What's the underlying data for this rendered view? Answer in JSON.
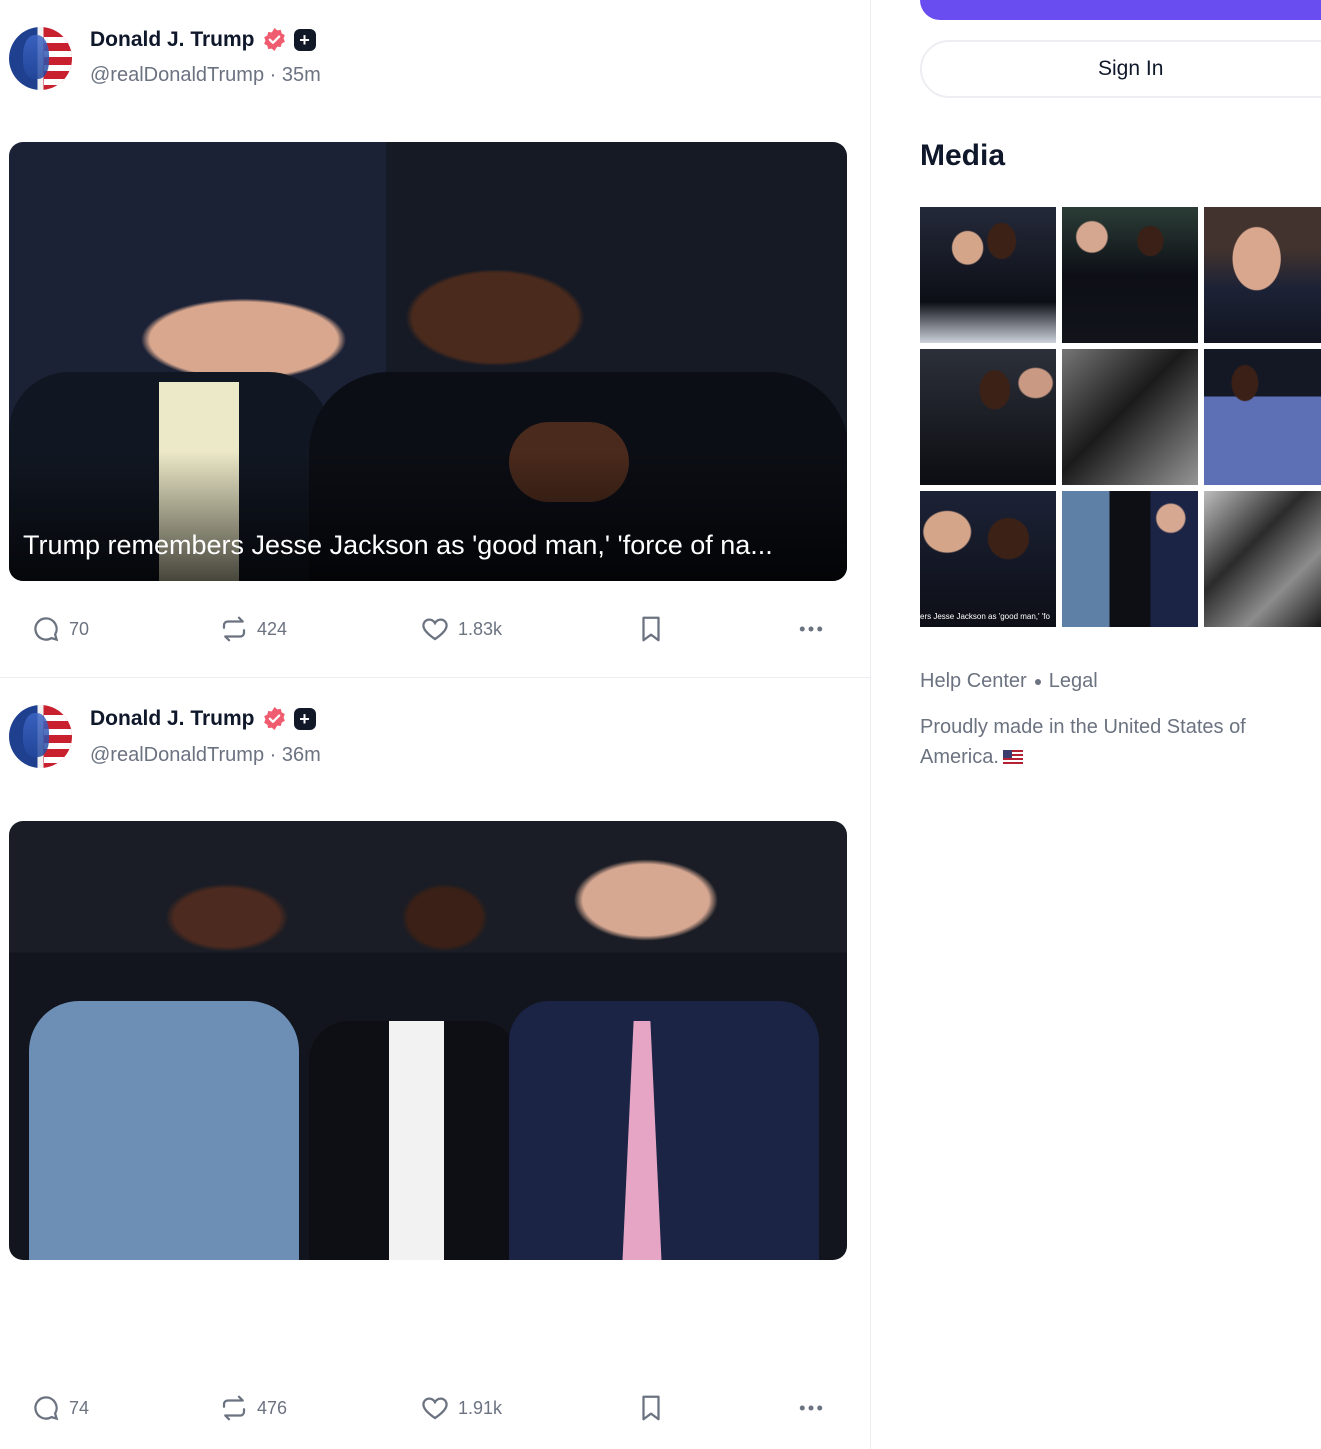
{
  "posts": [
    {
      "display_name": "Donald J. Trump",
      "handle": "@realDonaldTrump",
      "time": "35m",
      "media_caption": "Trump remembers Jesse Jackson as 'good man,' 'force of na...",
      "stats": {
        "replies": "70",
        "retruths": "424",
        "likes": "1.83k"
      }
    },
    {
      "display_name": "Donald J. Trump",
      "handle": "@realDonaldTrump",
      "time": "36m",
      "media_caption": "",
      "stats": {
        "replies": "74",
        "retruths": "476",
        "likes": "1.91k"
      }
    }
  ],
  "sidebar": {
    "sign_in_label": "Sign In",
    "media_title": "Media",
    "thumb_caption": "ers Jesse Jackson as 'good man,' 'fo",
    "footer": {
      "help_center": "Help Center",
      "legal": "Legal"
    },
    "made_in": "Proudly made in the United States of America."
  },
  "colors": {
    "accent": "#6a4df0",
    "verified": "#f05c6f",
    "muted_text": "#6b7280"
  },
  "icons": [
    "verified-badge-icon",
    "plus-badge-icon",
    "reply-icon",
    "retruth-icon",
    "heart-icon",
    "bookmark-icon",
    "more-icon",
    "us-flag-icon"
  ]
}
